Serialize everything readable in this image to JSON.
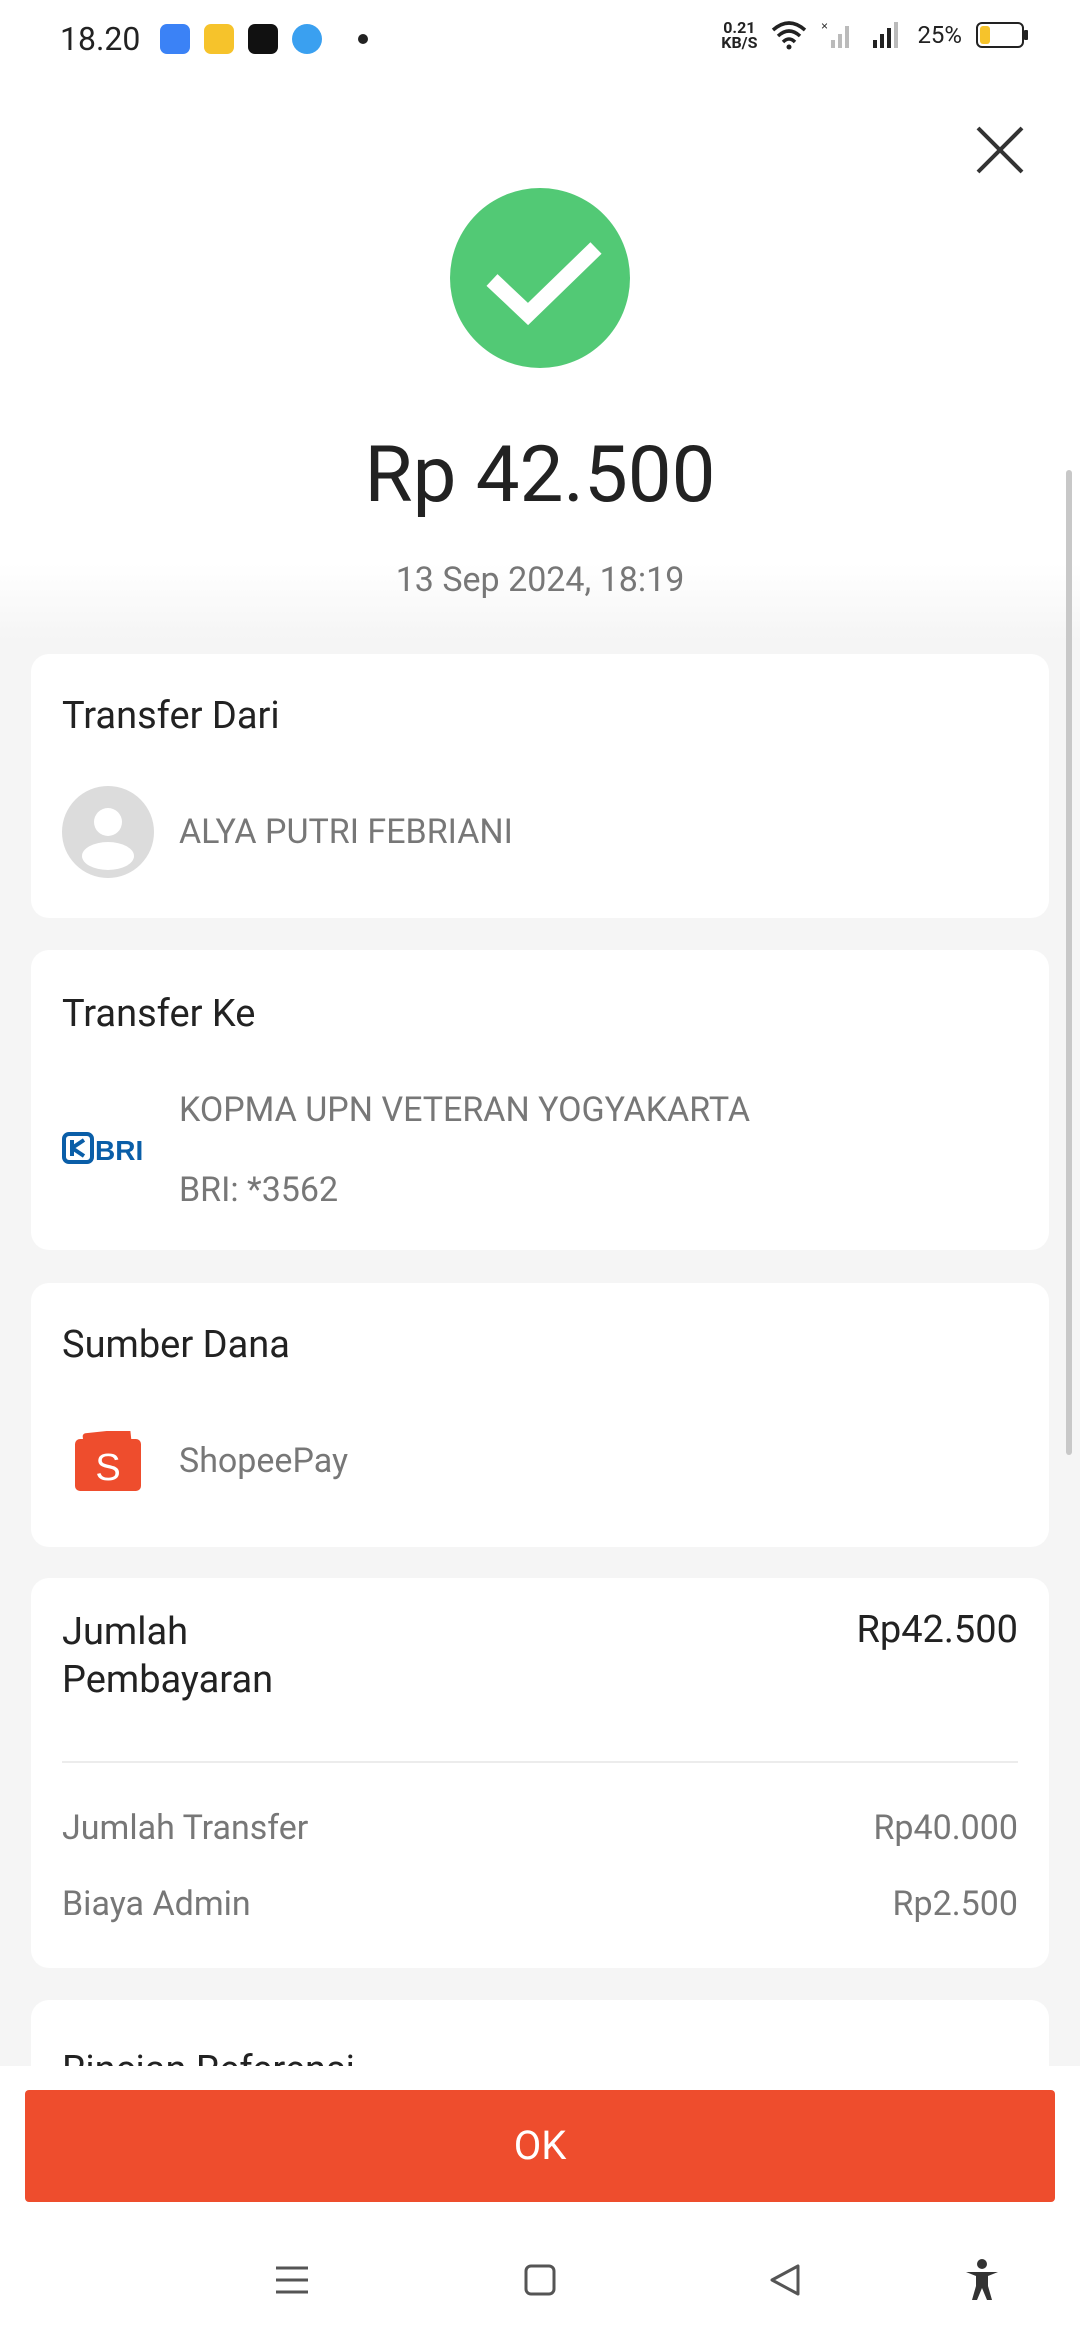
{
  "status_bar": {
    "time": "18.20",
    "net_speed_value": "0.21",
    "net_speed_unit": "KB/S",
    "battery_percent": "25%",
    "battery_level": 0.25
  },
  "receipt": {
    "amount": "Rp 42.500",
    "datetime": "13 Sep 2024, 18:19"
  },
  "transfer_from": {
    "title": "Transfer Dari",
    "name": "ALYA PUTRI FEBRIANI"
  },
  "transfer_to": {
    "title": "Transfer Ke",
    "name": "KOPMA UPN VETERAN YOGYAKARTA",
    "account": "BRI: *3562",
    "bank_logo_text": "BRI"
  },
  "source": {
    "title": "Sumber Dana",
    "name": "ShopeePay"
  },
  "payment": {
    "total_label": "Jumlah Pembayaran",
    "total_value": "Rp42.500",
    "rows": [
      {
        "label": "Jumlah Transfer",
        "value": "Rp40.000"
      },
      {
        "label": "Biaya Admin",
        "value": "Rp2.500"
      }
    ]
  },
  "reference": {
    "title": "Rincian Referensi"
  },
  "actions": {
    "ok_label": "OK"
  },
  "colors": {
    "success": "#52c975",
    "brand": "#ee4d2d",
    "bri_blue": "#0a5ea8"
  }
}
